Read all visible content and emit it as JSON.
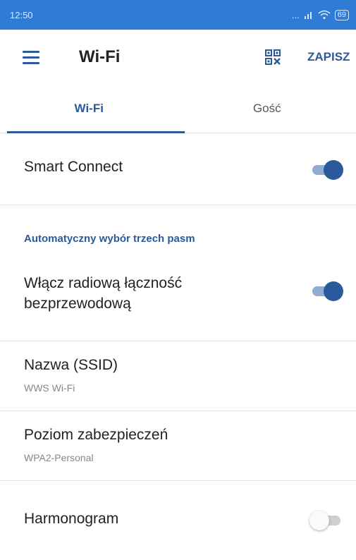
{
  "status_bar": {
    "time": "12:50",
    "signal": "...",
    "battery": "69"
  },
  "app_bar": {
    "title": "Wi-Fi",
    "save_label": "ZAPISZ"
  },
  "tabs": [
    {
      "label": "Wi-Fi",
      "active": true
    },
    {
      "label": "Gość",
      "active": false
    }
  ],
  "settings": {
    "smart_connect": {
      "label": "Smart Connect",
      "enabled": true
    },
    "section_title": "Automatyczny wybór trzech pasm",
    "wireless": {
      "label": "Włącz radiową łączność bezprzewodową",
      "enabled": true
    },
    "ssid": {
      "label": "Nazwa (SSID)",
      "value": "WWS Wi-Fi"
    },
    "security": {
      "label": "Poziom zabezpieczeń",
      "value": "WPA2-Personal"
    },
    "schedule": {
      "label": "Harmonogram",
      "enabled": false
    }
  },
  "colors": {
    "status_bar": "#2f7bd6",
    "accent": "#2a5a9c"
  }
}
